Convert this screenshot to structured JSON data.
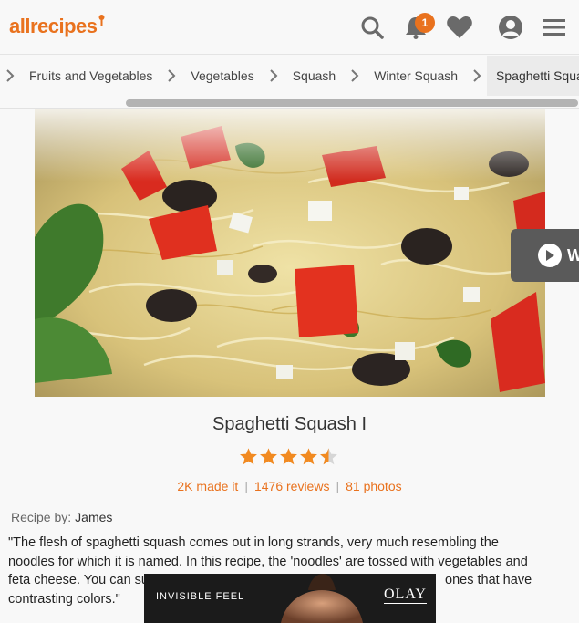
{
  "header": {
    "logo": "allrecipes",
    "notification_count": "1",
    "icons": [
      "search-icon",
      "bell-icon",
      "heart-icon",
      "profile-icon",
      "menu-icon"
    ],
    "accent_color": "#e9721e"
  },
  "breadcrumbs": {
    "items": [
      "Fruits and Vegetables",
      "Vegetables",
      "Squash",
      "Winter Squash",
      "Spaghetti Squash"
    ],
    "active_index": 4
  },
  "video": {
    "label": "W"
  },
  "recipe": {
    "title": "Spaghetti Squash I",
    "rating": 4.5,
    "made_it": "2K made it",
    "reviews": "1476 reviews",
    "photos": "81 photos",
    "byline_label": "Recipe by:",
    "author": "James",
    "description_visible_1": "\"The flesh of spaghetti squash comes out in long strands, very much resembling the",
    "description_visible_2": "noodles for which it is named. In this recipe, the 'noodles' are tossed with vegetables and",
    "description_visible_3a": "feta cheese. You can su",
    "description_visible_3b": "ones that have",
    "description_visible_4": "contrasting colors.\""
  },
  "ad": {
    "tagline": "INVISIBLE FEEL",
    "brand": "OLAY"
  }
}
